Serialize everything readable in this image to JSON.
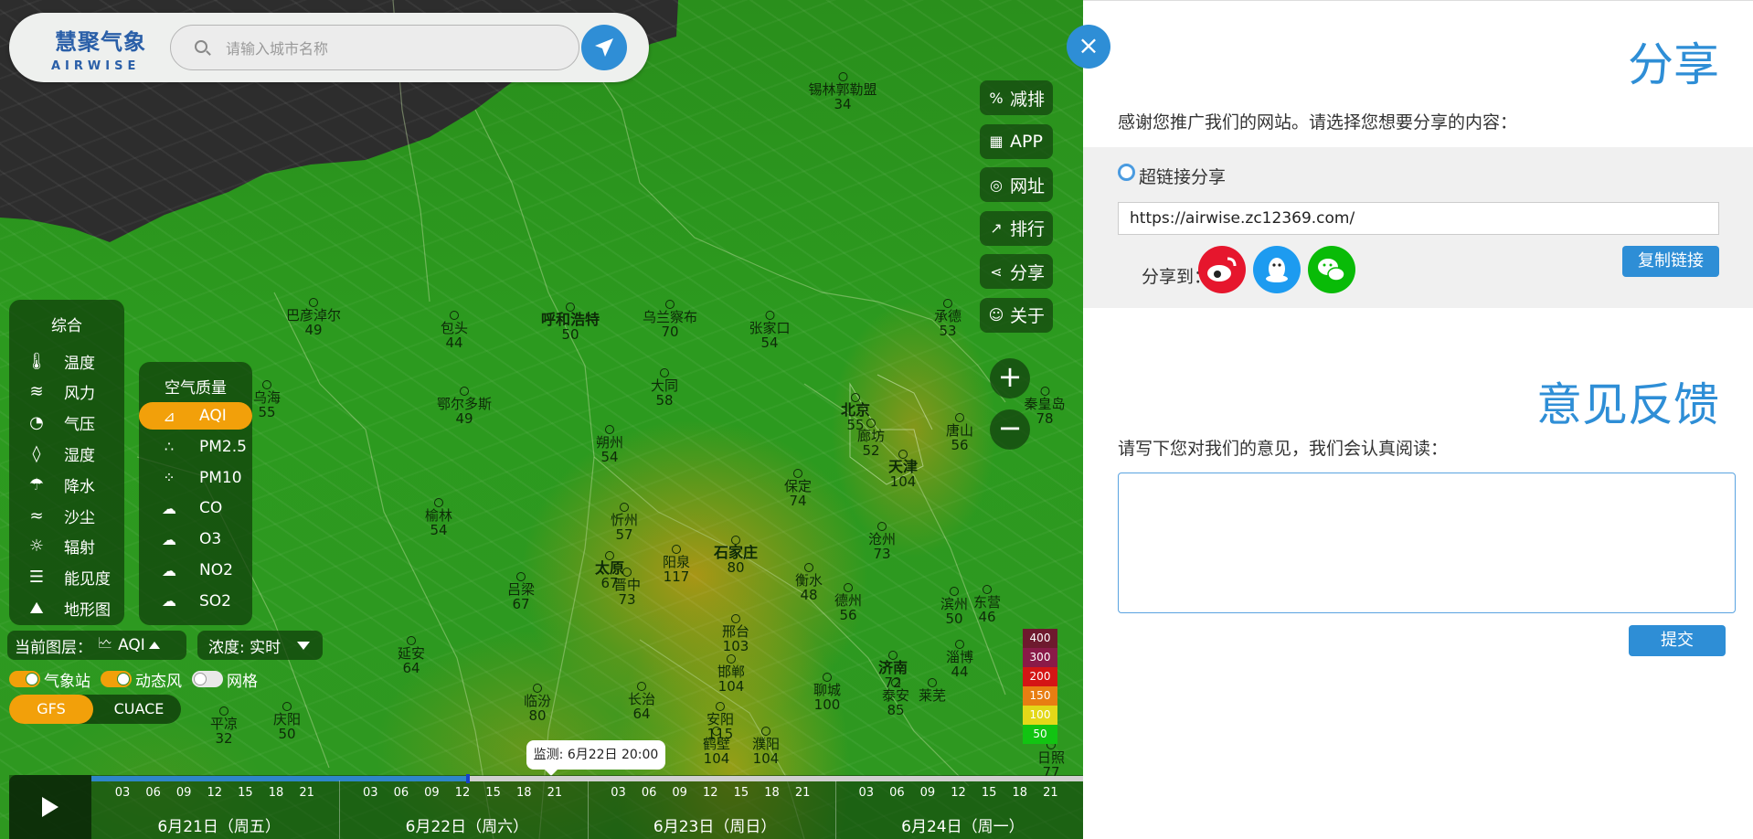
{
  "logo": {
    "cn": "慧聚气象",
    "en": "AIRWISE"
  },
  "search": {
    "placeholder": "请输入城市名称"
  },
  "tools": [
    {
      "label": "减排",
      "icon": "percent-icon"
    },
    {
      "label": "APP",
      "icon": "qrcode-icon"
    },
    {
      "label": "网址",
      "icon": "globe-icon"
    },
    {
      "label": "排行",
      "icon": "ranking-chart-icon"
    },
    {
      "label": "分享",
      "icon": "share-icon"
    },
    {
      "label": "关于",
      "icon": "people-icon"
    }
  ],
  "zoom": {
    "in": "+",
    "out": "−"
  },
  "general_panel": {
    "title": "综合",
    "items": [
      {
        "label": "温度",
        "icon": "thermometer-icon"
      },
      {
        "label": "风力",
        "icon": "wind-icon"
      },
      {
        "label": "气压",
        "icon": "gauge-icon"
      },
      {
        "label": "湿度",
        "icon": "droplet-icon"
      },
      {
        "label": "降水",
        "icon": "rain-icon"
      },
      {
        "label": "沙尘",
        "icon": "dust-icon"
      },
      {
        "label": "辐射",
        "icon": "radiation-icon"
      },
      {
        "label": "能见度",
        "icon": "visibility-icon"
      },
      {
        "label": "地形图",
        "icon": "terrain-icon"
      }
    ]
  },
  "air_panel": {
    "title": "空气质量",
    "items": [
      {
        "label": "AQI",
        "icon": "chart-icon",
        "active": true
      },
      {
        "label": "PM2.5",
        "icon": "particles-icon"
      },
      {
        "label": "PM10",
        "icon": "particles-large-icon"
      },
      {
        "label": "CO",
        "icon": "cloud-co-icon"
      },
      {
        "label": "O3",
        "icon": "cloud-o3-icon"
      },
      {
        "label": "NO2",
        "icon": "cloud-no2-icon"
      },
      {
        "label": "SO2",
        "icon": "cloud-so2-icon"
      }
    ]
  },
  "current_layer": {
    "label": "当前图层：",
    "value": "AQI"
  },
  "concentration": {
    "label": "浓度: 实时"
  },
  "toggles": [
    {
      "label": "气象站",
      "on": true
    },
    {
      "label": "动态风",
      "on": true
    },
    {
      "label": "网格",
      "on": false
    }
  ],
  "models": {
    "primary": "GFS",
    "secondary": "CUACE"
  },
  "legend": [
    {
      "value": "400",
      "color": "#6e1a2e"
    },
    {
      "value": "300",
      "color": "#8a1a48"
    },
    {
      "value": "200",
      "color": "#d41515"
    },
    {
      "value": "150",
      "color": "#e87e12"
    },
    {
      "value": "100",
      "color": "#e3d818"
    },
    {
      "value": "50",
      "color": "#12c412"
    }
  ],
  "cities": [
    {
      "name": "锡林郭勒盟",
      "value": "34",
      "bold": false
    },
    {
      "name": "巴彦淖尔",
      "value": "49",
      "bold": false
    },
    {
      "name": "包头",
      "value": "44",
      "bold": false
    },
    {
      "name": "呼和浩特",
      "value": "50",
      "bold": true
    },
    {
      "name": "乌兰察布",
      "value": "70",
      "bold": false
    },
    {
      "name": "张家口",
      "value": "54",
      "bold": false
    },
    {
      "name": "承德",
      "value": "53",
      "bold": false
    },
    {
      "name": "乌海",
      "value": "55",
      "bold": false
    },
    {
      "name": "鄂尔多斯",
      "value": "49",
      "bold": false
    },
    {
      "name": "大同",
      "value": "58",
      "bold": false
    },
    {
      "name": "北京",
      "value": "55",
      "bold": true
    },
    {
      "name": "廊坊",
      "value": "52",
      "bold": false
    },
    {
      "name": "唐山",
      "value": "56",
      "bold": false
    },
    {
      "name": "秦皇岛",
      "value": "78",
      "bold": false
    },
    {
      "name": "朔州",
      "value": "54",
      "bold": false
    },
    {
      "name": "天津",
      "value": "104",
      "bold": true
    },
    {
      "name": "保定",
      "value": "74",
      "bold": false
    },
    {
      "name": "榆林",
      "value": "54",
      "bold": false
    },
    {
      "name": "忻州",
      "value": "57",
      "bold": false
    },
    {
      "name": "沧州",
      "value": "73",
      "bold": false
    },
    {
      "name": "太原",
      "value": "67",
      "bold": true
    },
    {
      "name": "晋中",
      "value": "73",
      "bold": false
    },
    {
      "name": "阳泉",
      "value": "117",
      "bold": false
    },
    {
      "name": "石家庄",
      "value": "80",
      "bold": true
    },
    {
      "name": "衡水",
      "value": "48",
      "bold": false
    },
    {
      "name": "吕梁",
      "value": "67",
      "bold": false
    },
    {
      "name": "德州",
      "value": "56",
      "bold": false
    },
    {
      "name": "滨州",
      "value": "50",
      "bold": false
    },
    {
      "name": "东营",
      "value": "46",
      "bold": false
    },
    {
      "name": "邢台",
      "value": "103",
      "bold": false
    },
    {
      "name": "延安",
      "value": "64",
      "bold": false
    },
    {
      "name": "邯郸",
      "value": "104",
      "bold": false
    },
    {
      "name": "济南",
      "value": "72",
      "bold": true
    },
    {
      "name": "淄博",
      "value": "44",
      "bold": false
    },
    {
      "name": "临汾",
      "value": "80",
      "bold": false
    },
    {
      "name": "长治",
      "value": "64",
      "bold": false
    },
    {
      "name": "聊城",
      "value": "100",
      "bold": false
    },
    {
      "name": "泰安",
      "value": "85",
      "bold": false
    },
    {
      "name": "莱芜",
      "value": "",
      "bold": false
    },
    {
      "name": "安阳",
      "value": "115",
      "bold": false
    },
    {
      "name": "鹤壁",
      "value": "104",
      "bold": false
    },
    {
      "name": "濮阳",
      "value": "104",
      "bold": false
    },
    {
      "name": "平凉",
      "value": "32",
      "bold": false
    },
    {
      "name": "庆阳",
      "value": "50",
      "bold": false
    },
    {
      "name": "日照",
      "value": "77",
      "bold": false
    }
  ],
  "timeline": {
    "ticks": [
      "03",
      "06",
      "09",
      "12",
      "15",
      "18",
      "21"
    ],
    "days": [
      "6月21日（周五）",
      "6月22日（周六）",
      "6月23日（周日）",
      "6月24日（周一）"
    ],
    "progress": 0.38,
    "tooltip": "监测: 6月22日  20:00"
  },
  "share": {
    "title": "分享",
    "intro": "感谢您推广我们的网站。请选择您想要分享的内容：",
    "radio_label": "超链接分享",
    "link": "https://airwise.zc12369.com/",
    "share_to_label": "分享到：",
    "targets": [
      {
        "icon": "weibo-icon",
        "color": "#e6162d"
      },
      {
        "icon": "qq-icon",
        "color": "#1d9bf0"
      },
      {
        "icon": "wechat-icon",
        "color": "#09bb07"
      }
    ],
    "copy_label": "复制链接"
  },
  "feedback": {
    "title": "意见反馈",
    "intro": "请写下您对我们的意见，我们会认真阅读：",
    "submit_label": "提交"
  },
  "close_label": "×"
}
